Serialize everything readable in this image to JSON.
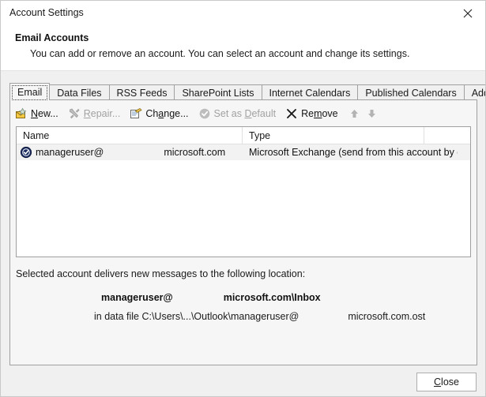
{
  "window": {
    "title": "Account Settings",
    "close_icon": "close-x-icon"
  },
  "header": {
    "title": "Email Accounts",
    "subtitle": "You can add or remove an account. You can select an account and change its settings."
  },
  "tabs": [
    {
      "label": "Email",
      "active": true
    },
    {
      "label": "Data Files",
      "active": false
    },
    {
      "label": "RSS Feeds",
      "active": false
    },
    {
      "label": "SharePoint Lists",
      "active": false
    },
    {
      "label": "Internet Calendars",
      "active": false
    },
    {
      "label": "Published Calendars",
      "active": false
    },
    {
      "label": "Address Books",
      "active": false
    }
  ],
  "toolbar": {
    "new_label": "New...",
    "new_mnemonic": "N",
    "repair_label": "Repair...",
    "repair_mnemonic": "R",
    "change_label": "Change...",
    "change_mnemonic": "a",
    "set_default_label": "Set as Default",
    "set_default_mnemonic": "D",
    "remove_label": "Remove",
    "remove_mnemonic": "m",
    "move_up_label": "Move Up",
    "move_down_label": "Move Down",
    "disabled_items": [
      "Repair...",
      "Set as Default",
      "Move Up",
      "Move Down"
    ]
  },
  "list": {
    "columns": [
      "Name",
      "Type"
    ],
    "rows": [
      {
        "name_prefix": "manageruser@",
        "name_suffix": "microsoft.com",
        "type": "Microsoft Exchange (send from this account by def...",
        "selected": true,
        "icon": "default-account-check-icon"
      }
    ]
  },
  "delivery": {
    "label": "Selected account delivers new messages to the following location:",
    "location_prefix": "manageruser@",
    "location_suffix": "microsoft.com\\Inbox",
    "datafile_prefix": "in data file C:\\Users\\...\\Outlook\\manageruser@",
    "datafile_suffix": "microsoft.com.ost"
  },
  "footer": {
    "close_label": "Close",
    "close_mnemonic": "C"
  },
  "colors": {
    "dialog_bg": "#ffffff",
    "panel_bg": "#f6f6f6",
    "body_bg": "#f0f0f0",
    "border": "#a0a0a0",
    "selection": "#f2f2f2",
    "disabled_text": "#a2a2a2",
    "text": "#1a1a1a"
  }
}
